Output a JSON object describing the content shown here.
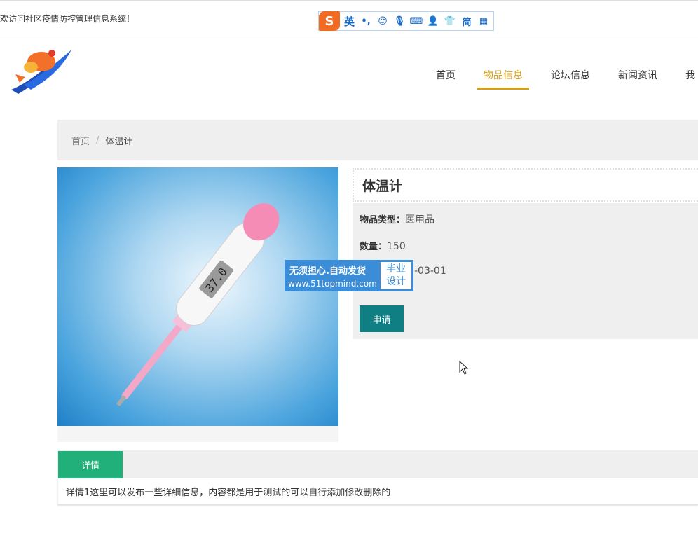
{
  "topbar": {
    "welcome": "欢访问社区疫情防控管理信息系统！"
  },
  "ime": {
    "logo": "S",
    "mode": "英",
    "icons": [
      "punct-icon",
      "emoji-icon",
      "mic-icon",
      "keyboard-icon",
      "user-icon",
      "skin-icon",
      "simplified-icon",
      "grid-icon"
    ],
    "simplified": "简"
  },
  "nav": {
    "items": [
      "首页",
      "物品信息",
      "论坛信息",
      "新闻资讯",
      "我"
    ]
  },
  "breadcrumb": {
    "home": "首页",
    "sep": "/",
    "current": "体温计"
  },
  "product": {
    "title": "体温计",
    "type_label": "物品类型：",
    "type_value": "医用品",
    "qty_label": "数量：",
    "qty_value": "150",
    "date_value": "-03-01",
    "apply": "申请"
  },
  "watermark": {
    "line1": "无须担心.自动发货",
    "line2": "www.51topmind.com",
    "badge1": "毕业",
    "badge2": "设计"
  },
  "tabs": {
    "detail": "详情"
  },
  "detail_text": "详情1这里可以发布一些详细信息，内容都是用于测试的可以自行添加修改删除的",
  "colors": {
    "accent": "#d4a017",
    "apply": "#107f83",
    "tab": "#22b07a"
  }
}
